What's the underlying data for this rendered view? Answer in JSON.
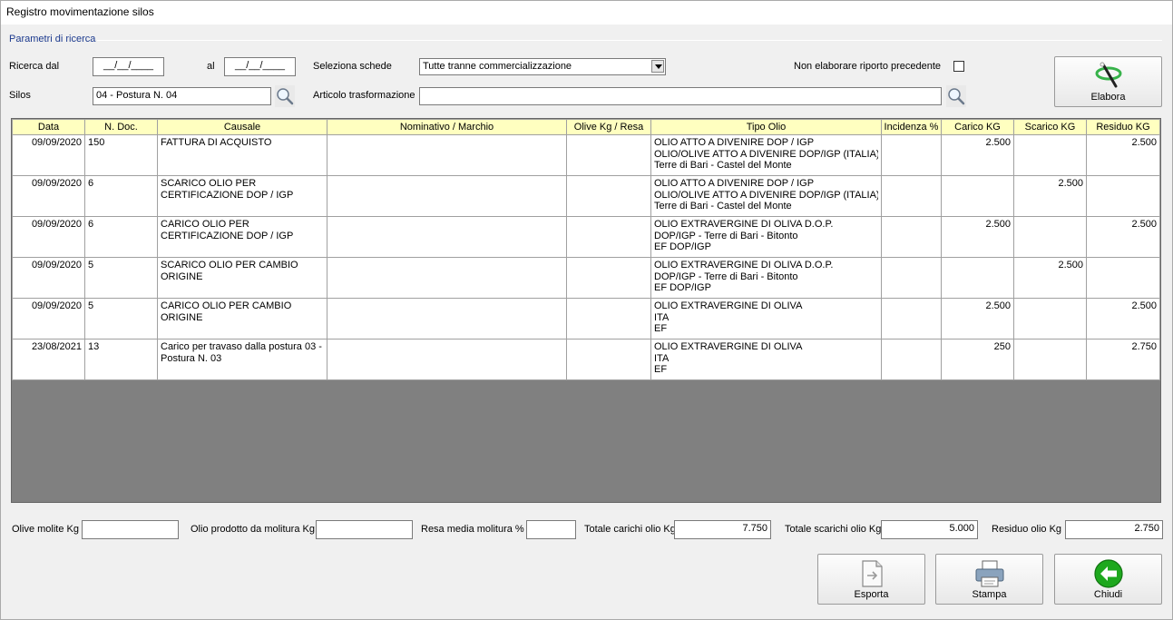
{
  "window": {
    "title": "Registro movimentazione silos"
  },
  "params": {
    "group_label": "Parametri di ricerca",
    "ricerca_dal_label": "Ricerca dal",
    "date_from": "__/__/____",
    "al_label": "al",
    "date_to": "__/__/____",
    "seleziona_schede_label": "Seleziona schede",
    "seleziona_schede_value": "Tutte tranne commercializzazione",
    "non_elaborare_label": "Non elaborare riporto precedente",
    "non_elaborare_checked": false,
    "silos_label": "Silos",
    "silos_value": "04 - Postura N. 04",
    "articolo_label": "Articolo trasformazione",
    "articolo_value": ""
  },
  "buttons": {
    "elabora": "Elabora",
    "esporta": "Esporta",
    "stampa": "Stampa",
    "chiudi": "Chiudi"
  },
  "table": {
    "columns": [
      "Data",
      "N. Doc.",
      "Causale",
      "Nominativo / Marchio",
      "Olive Kg / Resa",
      "Tipo Olio",
      "Incidenza %",
      "Carico KG",
      "Scarico KG",
      "Residuo KG"
    ],
    "rows": [
      {
        "data": "09/09/2020",
        "ndoc": "150",
        "causale": "FATTURA DI ACQUISTO",
        "nominativo": "",
        "olive": "",
        "tipo": [
          "OLIO ATTO A DIVENIRE DOP / IGP",
          "OLIO/OLIVE ATTO A DIVENIRE DOP/IGP (ITALIA) -",
          "Terre di Bari - Castel del Monte"
        ],
        "incidenza": "",
        "carico": "2.500",
        "scarico": "",
        "residuo": "2.500"
      },
      {
        "data": "09/09/2020",
        "ndoc": "6",
        "causale": "SCARICO OLIO  PER CERTIFICAZIONE DOP / IGP",
        "nominativo": "",
        "olive": "",
        "tipo": [
          "OLIO ATTO A DIVENIRE DOP / IGP",
          "OLIO/OLIVE ATTO A DIVENIRE DOP/IGP (ITALIA) -",
          "Terre di Bari - Castel del Monte"
        ],
        "incidenza": "",
        "carico": "",
        "scarico": "2.500",
        "residuo": ""
      },
      {
        "data": "09/09/2020",
        "ndoc": "6",
        "causale": "CARICO OLIO PER CERTIFICAZIONE DOP / IGP",
        "nominativo": "",
        "olive": "",
        "tipo": [
          "OLIO EXTRAVERGINE DI OLIVA D.O.P.",
          "DOP/IGP - Terre di Bari - Bitonto",
          "EF DOP/IGP"
        ],
        "incidenza": "",
        "carico": "2.500",
        "scarico": "",
        "residuo": "2.500"
      },
      {
        "data": "09/09/2020",
        "ndoc": "5",
        "causale": "SCARICO OLIO PER CAMBIO ORIGINE",
        "nominativo": "",
        "olive": "",
        "tipo": [
          "OLIO EXTRAVERGINE DI OLIVA D.O.P.",
          "DOP/IGP - Terre di Bari - Bitonto",
          "EF DOP/IGP"
        ],
        "incidenza": "",
        "carico": "",
        "scarico": "2.500",
        "residuo": ""
      },
      {
        "data": "09/09/2020",
        "ndoc": "5",
        "causale": "CARICO OLIO PER CAMBIO ORIGINE",
        "nominativo": "",
        "olive": "",
        "tipo": [
          "OLIO EXTRAVERGINE DI OLIVA",
          "ITA",
          "EF"
        ],
        "incidenza": "",
        "carico": "2.500",
        "scarico": "",
        "residuo": "2.500"
      },
      {
        "data": "23/08/2021",
        "ndoc": "13",
        "causale": "Carico per travaso dalla postura 03 - Postura N. 03",
        "nominativo": "",
        "olive": "",
        "tipo": [
          "OLIO EXTRAVERGINE DI OLIVA",
          "ITA",
          "EF"
        ],
        "incidenza": "",
        "carico": "250",
        "scarico": "",
        "residuo": "2.750"
      }
    ]
  },
  "totals": {
    "olive_molite_label": "Olive molite Kg",
    "olive_molite_value": "",
    "olio_prodotto_label": "Olio prodotto da molitura Kg",
    "olio_prodotto_value": "",
    "resa_media_label": "Resa media molitura %",
    "resa_media_value": "",
    "totale_carichi_label": "Totale carichi olio Kg",
    "totale_carichi_value": "7.750",
    "totale_scarichi_label": "Totale scarichi olio Kg",
    "totale_scarichi_value": "5.000",
    "residuo_label": "Residuo olio Kg",
    "residuo_value": "2.750"
  },
  "icons": {
    "search": "magnifier-icon",
    "elabora": "wand-icon",
    "esporta": "document-export-icon",
    "stampa": "printer-icon",
    "chiudi": "back-arrow-icon"
  },
  "colors": {
    "header_bg": "#ffffc0",
    "grid_empty": "#808080",
    "group_label": "#1c3a8e",
    "chiudi_green": "#1ea81e"
  }
}
